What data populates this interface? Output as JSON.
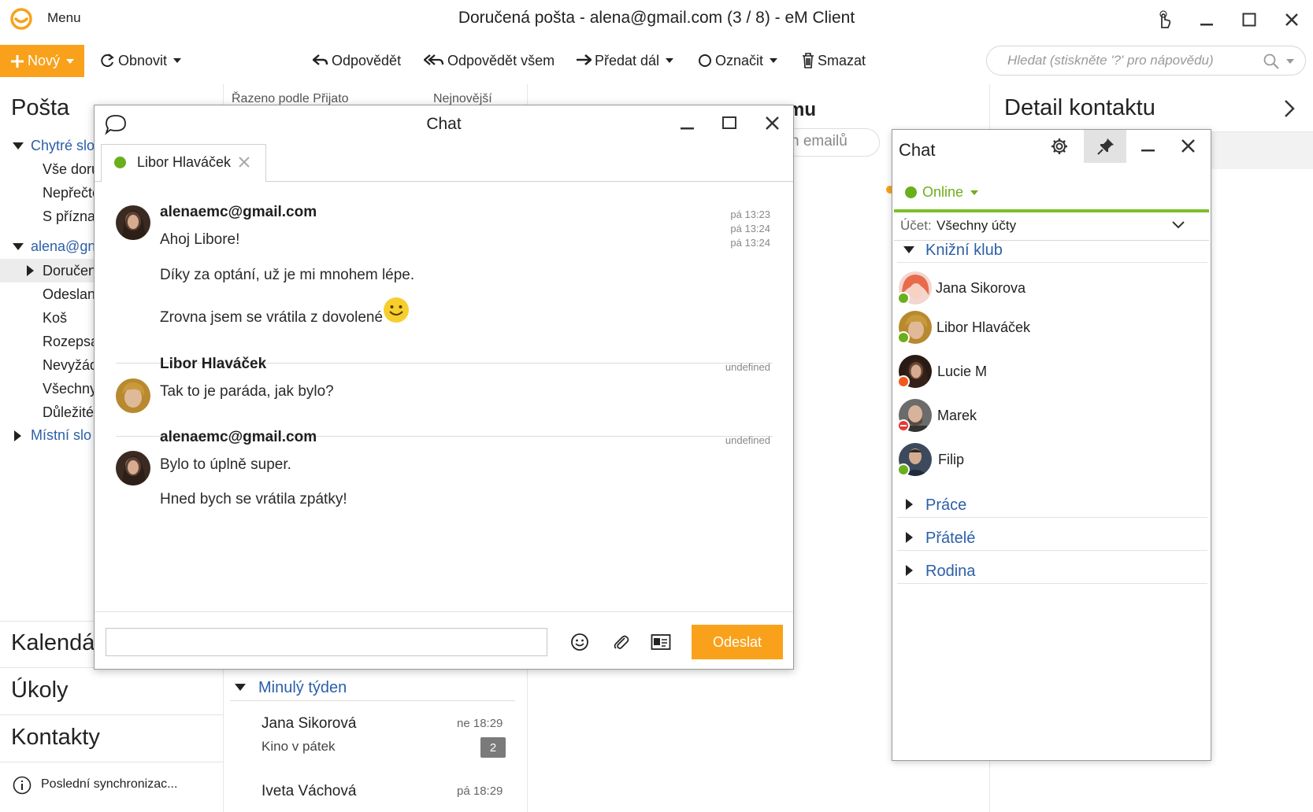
{
  "window": {
    "menu_label": "Menu",
    "title": "Doručená pošta - alena@gmail.com (3 / 8) - eM Client"
  },
  "toolbar": {
    "new_label": "Nový",
    "refresh_label": "Obnovit",
    "reply_label": "Odpovědět",
    "reply_all_label": "Odpovědět všem",
    "forward_label": "Předat dál",
    "mark_label": "Označit",
    "delete_label": "Smazat",
    "search_placeholder": "Hledat (stiskněte '?' pro nápovědu)"
  },
  "nav": {
    "mail_header": "Pošta",
    "smart_folders": "Chytré slo",
    "smart_items": [
      "Vše doru",
      "Nepřečte",
      "S přízna"
    ],
    "account": "alena@gn",
    "account_items": [
      "Doručen",
      "Odeslan",
      "Koš",
      "Rozepsa",
      "Nevyžád",
      "Všechny",
      "Důležité"
    ],
    "local_folders": "Místní slo",
    "calendar": "Kalendá",
    "tasks": "Úkoly",
    "contacts": "Kontakty",
    "sync_status": "Poslední synchronizac..."
  },
  "list": {
    "sort_label": "Řazeno podle Přijato",
    "order_label": "Nejnovější",
    "week_group": "Minulý týden",
    "items": [
      {
        "sender": "Jana Sikorová",
        "subject": "Kino v pátek",
        "time": "ne 18:29",
        "count": "2"
      },
      {
        "sender": "Iveta Váchová",
        "subject": "",
        "time": "pá 18:29"
      }
    ]
  },
  "reading": {
    "title_fragment": "mu",
    "pill_fragment": "n emailů"
  },
  "detail": {
    "title": "Detail kontaktu"
  },
  "chat_window": {
    "title": "Chat",
    "tab_contact": "Libor Hlaváček",
    "messages": [
      {
        "sender": "alenaemc@gmail.com",
        "lines": [
          "Ahoj Libore!",
          "Díky za optání, už je mi mnohem lépe.",
          "Zrovna jsem se vrátila z dovolené"
        ],
        "times": [
          "pá 13:23",
          "pá 13:24",
          "pá 13:24"
        ]
      },
      {
        "sender": "Libor Hlaváček",
        "lines": [
          "Tak to je paráda, jak bylo?"
        ],
        "times": [
          "undefined"
        ]
      },
      {
        "sender": "alenaemc@gmail.com",
        "lines": [
          "Bylo to úplně super.",
          "Hned bych se vrátila zpátky!"
        ],
        "times": [
          "undefined"
        ]
      }
    ],
    "send_label": "Odeslat"
  },
  "chat_sidebar": {
    "title": "Chat",
    "status": "Online",
    "account_label": "Účet:",
    "account_value": "Všechny účty",
    "groups": [
      "Knižní klub",
      "Práce",
      "Přátelé",
      "Rodina"
    ],
    "contacts": [
      {
        "name": "Jana Sikorova",
        "status": "online"
      },
      {
        "name": "Libor Hlaváček",
        "status": "online"
      },
      {
        "name": "Lucie M",
        "status": "away"
      },
      {
        "name": "Marek",
        "status": "busy"
      },
      {
        "name": "Filip",
        "status": "online"
      }
    ]
  },
  "colors": {
    "accent": "#f9a11b",
    "link_blue": "#2b5fa8",
    "online": "#6aaf1c",
    "away": "#f05a1e",
    "busy": "#e53935"
  }
}
